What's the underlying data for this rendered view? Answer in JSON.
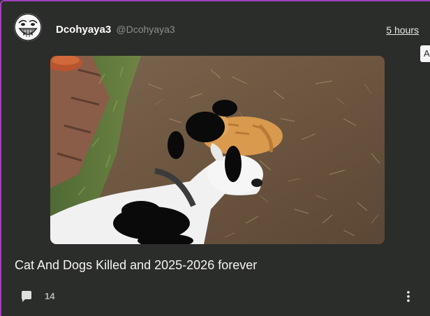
{
  "post": {
    "author": {
      "display_name": "Dcohyaya3",
      "handle": "@Dcohyaya3",
      "avatar_icon": "trollface-avatar"
    },
    "timestamp": "5 hours",
    "edge_tab_label": "A",
    "media": {
      "icon": "photo-dog-and-cat"
    },
    "title": "Cat And Dogs Killed and 2025-2026 forever",
    "actions": {
      "comment_icon": "comment-icon",
      "comment_count": "14",
      "more_icon": "more-vertical-icon"
    }
  },
  "colors": {
    "background": "#2b2d2a",
    "border_accent": "#a23fbd",
    "text_primary": "#f4f4f4",
    "text_muted": "#8d8f8b"
  }
}
